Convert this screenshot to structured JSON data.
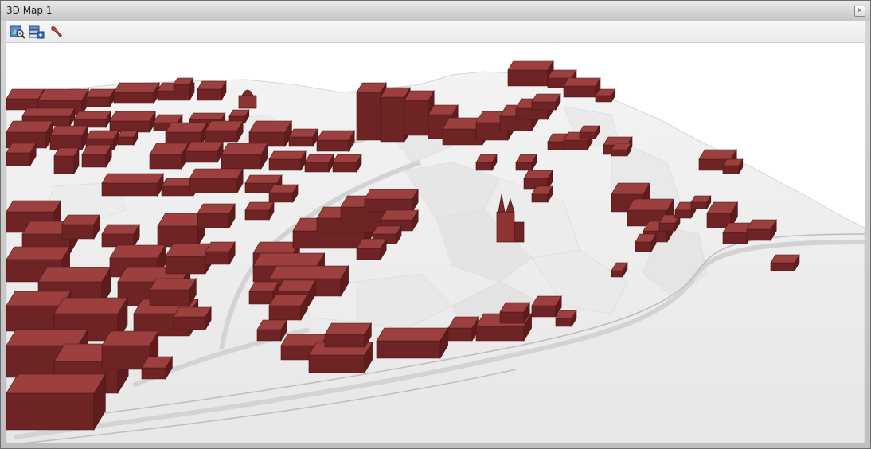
{
  "window": {
    "title": "3D Map 1",
    "close_label": "×"
  },
  "toolbar": {
    "tools": [
      {
        "name": "zoom-to-layer",
        "icon": "zoom-extent-icon"
      },
      {
        "name": "layer-properties",
        "icon": "layers-icon"
      },
      {
        "name": "scene-settings",
        "icon": "wrench-icon"
      }
    ]
  },
  "scene": {
    "terrain_color": "#efefef",
    "building_top_color": "#9b3f3f",
    "building_side_color": "#6e2424",
    "building_edge_color": "#4a1515"
  }
}
